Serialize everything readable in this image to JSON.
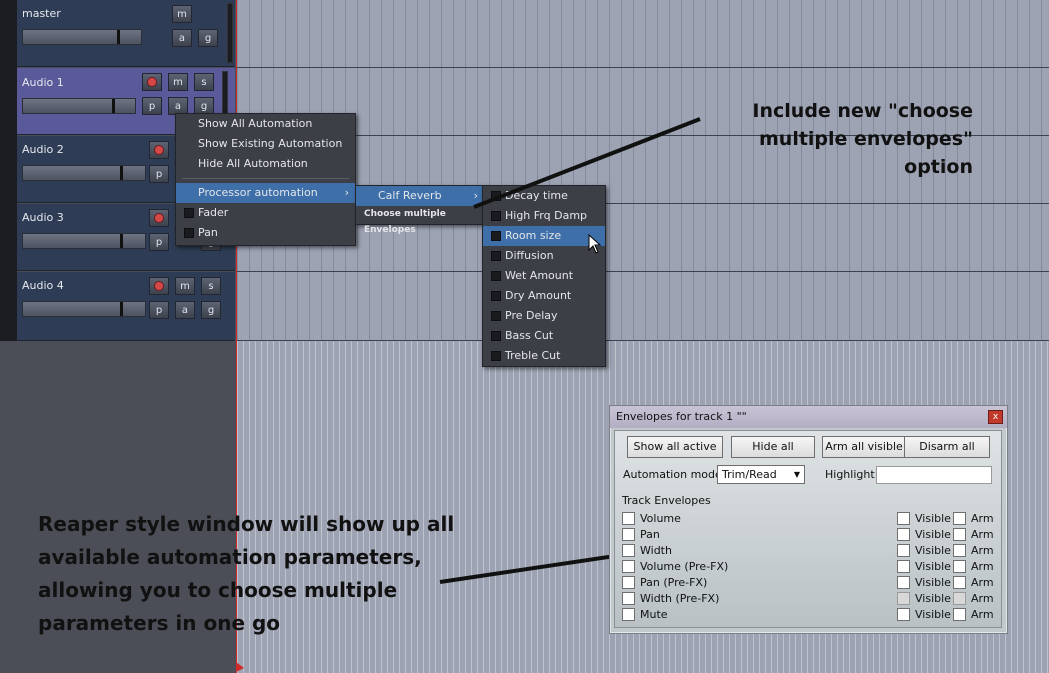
{
  "tracks": [
    {
      "name": "master",
      "buttons": [
        "m",
        "a",
        "g"
      ]
    },
    {
      "name": "Audio 1",
      "buttons": [
        "m",
        "s",
        "p",
        "a",
        "g"
      ]
    },
    {
      "name": "Audio 2",
      "buttons": [
        "p"
      ]
    },
    {
      "name": "Audio 3",
      "buttons": [
        "p",
        "g"
      ]
    },
    {
      "name": "Audio 4",
      "buttons": [
        "m",
        "s",
        "p",
        "a",
        "g"
      ]
    }
  ],
  "context_menu": {
    "items": [
      "Show All Automation",
      "Show Existing Automation",
      "Hide All Automation",
      "Processor automation",
      "Fader",
      "Pan"
    ],
    "submenu_arrow": "›"
  },
  "processor_menu": {
    "items": [
      "Calf Reverb",
      "Choose multiple Envelopes"
    ]
  },
  "param_menu": {
    "items": [
      "Decay time",
      "High Frq Damp",
      "Room size",
      "Diffusion",
      "Wet Amount",
      "Dry Amount",
      "Pre Delay",
      "Bass Cut",
      "Treble Cut"
    ],
    "highlighted": "Room size"
  },
  "annotations": {
    "top": [
      "Include new \"choose",
      "multiple envelopes\" option"
    ],
    "bottom": [
      "Reaper style window will show up all",
      "available automation parameters,",
      "allowing you to choose multiple",
      "parameters in one go"
    ]
  },
  "dialog": {
    "title": "Envelopes for track 1 \"\"",
    "close": "x",
    "buttons": [
      "Show all active",
      "Hide all",
      "Arm all visible",
      "Disarm all"
    ],
    "automation_mode_label": "Automation mode:",
    "automation_mode_value": "Trim/Read",
    "highlight_label": "Highlight:",
    "section_label": "Track Envelopes",
    "visible_label": "Visible",
    "arm_label": "Arm",
    "envelopes": [
      "Volume",
      "Pan",
      "Width",
      "Volume (Pre-FX)",
      "Pan (Pre-FX)",
      "Width (Pre-FX)",
      "Mute"
    ]
  },
  "colors": {
    "menu_bg": "#3c3f46",
    "menu_highlight": "#3e6fa8",
    "track_bg": "#2e3d55",
    "track_selected": "#5a5a9a",
    "record_red": "#d54848"
  }
}
